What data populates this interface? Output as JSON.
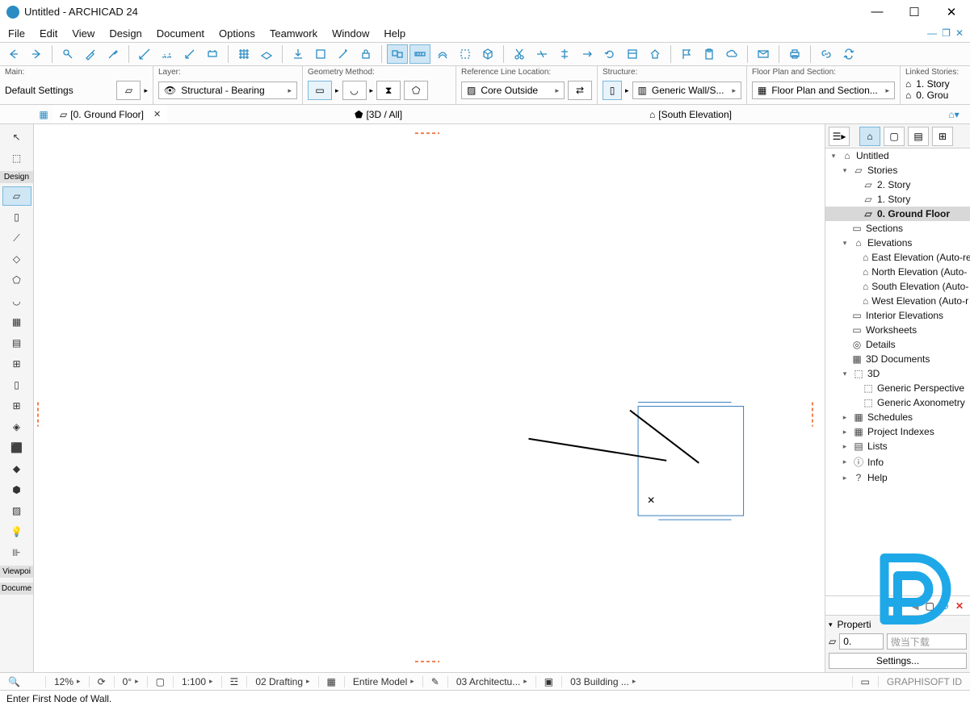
{
  "window": {
    "title": "Untitled - ARCHICAD 24"
  },
  "menu": {
    "file": "File",
    "edit": "Edit",
    "view": "View",
    "design": "Design",
    "document": "Document",
    "options": "Options",
    "teamwork": "Teamwork",
    "window": "Window",
    "help": "Help"
  },
  "infobox": {
    "main_label": "Main:",
    "main_value": "Default Settings",
    "layer_label": "Layer:",
    "layer_value": "Structural - Bearing",
    "geom_label": "Geometry Method:",
    "ref_label": "Reference Line Location:",
    "ref_value": "Core Outside",
    "struct_label": "Structure:",
    "struct_value": "Generic Wall/S...",
    "floor_label": "Floor Plan and Section:",
    "floor_value": "Floor Plan and Section...",
    "linked_label": "Linked Stories:",
    "linked_1": "1. Story",
    "linked_0": "0. Grou"
  },
  "tabs": {
    "ground": "[0. Ground Floor]",
    "threed": "[3D / All]",
    "south": "[South Elevation]"
  },
  "toolbox": {
    "design": "Design",
    "viewpoi": "Viewpoi",
    "docume": "Docume"
  },
  "navigator": {
    "untitled": "Untitled",
    "stories": "Stories",
    "story2": "2. Story",
    "story1": "1. Story",
    "ground": "0. Ground Floor",
    "sections": "Sections",
    "elevations": "Elevations",
    "east": "East Elevation (Auto-re",
    "north": "North Elevation (Auto-",
    "south": "South Elevation (Auto-",
    "west": "West Elevation (Auto-r",
    "interior": "Interior Elevations",
    "worksheets": "Worksheets",
    "details": "Details",
    "docs3d": "3D Documents",
    "threed": "3D",
    "persp": "Generic Perspective",
    "axo": "Generic Axonometry",
    "schedules": "Schedules",
    "indexes": "Project Indexes",
    "lists": "Lists",
    "info": "Info",
    "help": "Help"
  },
  "properties": {
    "title": "Properti",
    "box": "0.",
    "settings": "Settings..."
  },
  "status": {
    "zoom": "12%",
    "angle": "0°",
    "scale": "1:100",
    "layer": "02 Drafting",
    "model": "Entire Model",
    "arch": "03 Architectu...",
    "build": "03 Building ...",
    "hint": "Enter First Node of Wall.",
    "gid": "GRAPHISOFT ID"
  },
  "watermark": "微当下载"
}
